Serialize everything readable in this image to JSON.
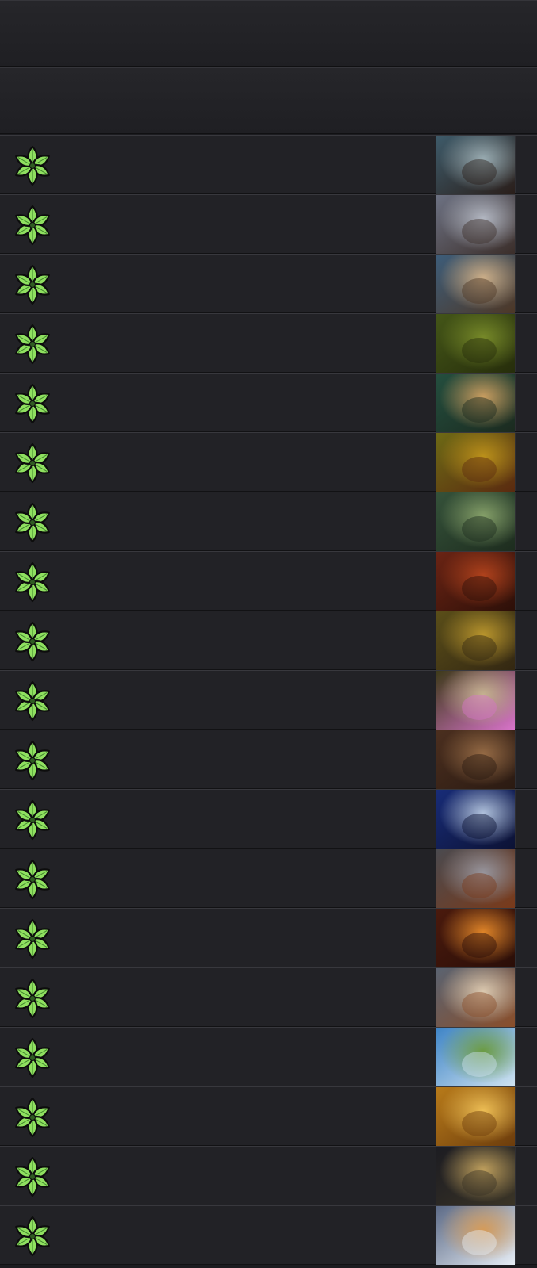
{
  "colors": {
    "background": "#1c1c20",
    "row": "#222226",
    "faction_icon": "#8fe060"
  },
  "faction_icon_name": "monsters-leaf-icon",
  "card_rows": [
    {
      "art_colors": [
        "#3e5b6a",
        "#9fb2b8",
        "#2a1e1a"
      ]
    },
    {
      "art_colors": [
        "#6d7283",
        "#b7bcc7",
        "#3b2e2a"
      ]
    },
    {
      "art_colors": [
        "#3d5d7a",
        "#d3b48c",
        "#4d3726"
      ]
    },
    {
      "art_colors": [
        "#445618",
        "#7a8d2a",
        "#262d0b"
      ]
    },
    {
      "art_colors": [
        "#244f3f",
        "#d2a363",
        "#1b2a1f"
      ]
    },
    {
      "art_colors": [
        "#6d6a15",
        "#c0941b",
        "#5a2a10"
      ]
    },
    {
      "art_colors": [
        "#35523a",
        "#8aa56c",
        "#1d2c1e"
      ]
    },
    {
      "art_colors": [
        "#6b2414",
        "#b5441d",
        "#2c0f08"
      ]
    },
    {
      "art_colors": [
        "#5a4e19",
        "#bf9a2e",
        "#332712"
      ]
    },
    {
      "art_colors": [
        "#3c3a18",
        "#c7b690",
        "#d873c9"
      ]
    },
    {
      "art_colors": [
        "#4b2f1f",
        "#9a6e47",
        "#2a1a12"
      ]
    },
    {
      "art_colors": [
        "#182c78",
        "#b9cbe4",
        "#0c1234"
      ]
    },
    {
      "art_colors": [
        "#4a4a4f",
        "#9a9aa3",
        "#7a3a1a"
      ]
    },
    {
      "art_colors": [
        "#4a1a0d",
        "#e98b2a",
        "#2a0e08"
      ]
    },
    {
      "art_colors": [
        "#5a6371",
        "#e1cfb5",
        "#8a4e2a"
      ]
    },
    {
      "art_colors": [
        "#3e84c6",
        "#6a9a3a",
        "#cfe3f1"
      ]
    },
    {
      "art_colors": [
        "#b87b1a",
        "#f2c358",
        "#6c3c0c"
      ]
    },
    {
      "art_colors": [
        "#1c1c22",
        "#c7a660",
        "#3a3426"
      ]
    },
    {
      "art_colors": [
        "#5c6a86",
        "#d79a54",
        "#e6edf5"
      ]
    }
  ]
}
